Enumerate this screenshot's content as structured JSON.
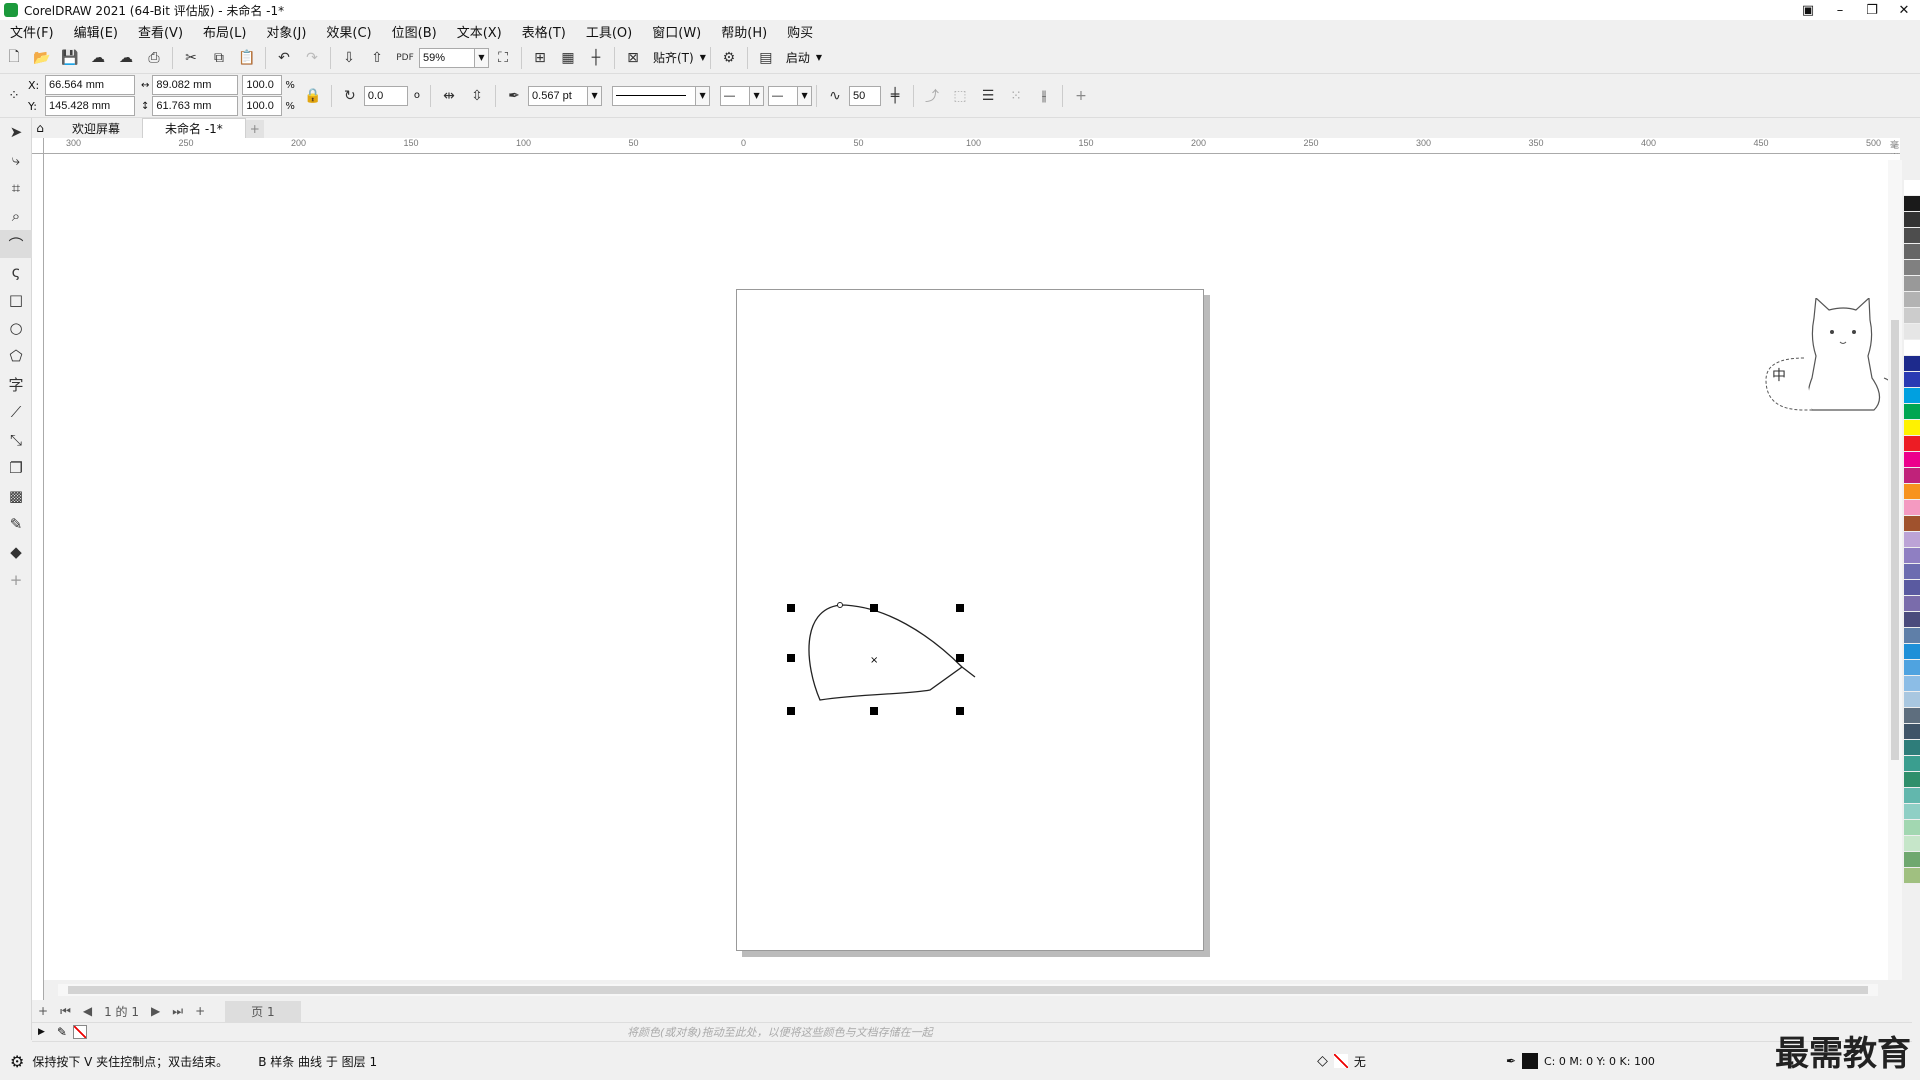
{
  "window": {
    "title": "CorelDRAW 2021 (64-Bit 评估版) - 未命名 -1*"
  },
  "menu": [
    "文件(F)",
    "编辑(E)",
    "查看(V)",
    "布局(L)",
    "对象(J)",
    "效果(C)",
    "位图(B)",
    "文本(X)",
    "表格(T)",
    "工具(O)",
    "窗口(W)",
    "帮助(H)",
    "购买"
  ],
  "toolbar1": {
    "zoom": "59%",
    "snap_label": "贴齐(T)",
    "launch_label": "启动"
  },
  "toolbar2": {
    "x_label": "X:",
    "x_value": "66.564 mm",
    "y_label": "Y:",
    "y_value": "145.428 mm",
    "w_value": "89.082 mm",
    "h_value": "61.763 mm",
    "sx_value": "100.0",
    "sy_value": "100.0",
    "pct": "%",
    "rotate_value": "0.0",
    "rotate_unit": "o",
    "outline_width": "0.567 pt",
    "smooth_value": "50"
  },
  "tabs": [
    {
      "label": "欢迎屏幕"
    },
    {
      "label": "未命名 -1*"
    }
  ],
  "ruler_h": [
    "300",
    "250",
    "200",
    "150",
    "100",
    "50",
    "0",
    "50",
    "100",
    "150",
    "200",
    "250",
    "300",
    "350",
    "400",
    "450",
    "500"
  ],
  "ruler_unit": "毫米",
  "pagebar": {
    "page_of": "1 的 1",
    "page_tab": "页 1"
  },
  "color_hint": "将颜色(或对象)拖动至此处，以便将这些颜色与文档存储在一起",
  "status": {
    "hint": "保持按下 V 夹住控制点；双击结束。",
    "object_info": "B 样条 曲线 于 图层 1",
    "fill_label": "无",
    "cmyk": "C: 0 M: 0 Y: 0 K: 100"
  },
  "mascot_text": "中",
  "watermark": "最需教育",
  "palette": [
    "#ffffff",
    "#1a1a1a",
    "#333333",
    "#4d4d4d",
    "#666666",
    "#808080",
    "#999999",
    "#b3b3b3",
    "#cccccc",
    "#e6e6e6",
    "#ffffff",
    "#1d2a8c",
    "#2a3ab3",
    "#00a0e0",
    "#00a651",
    "#fff200",
    "#ed1c24",
    "#ec008c",
    "#c0227a",
    "#f7931e",
    "#f49ac1",
    "#a0522d",
    "#bca3d6",
    "#8f7fc2",
    "#6c6cb0",
    "#5a5aa0",
    "#7a6cab",
    "#4b4b7c",
    "#5f7fa8",
    "#1e90d8",
    "#4fa3e0",
    "#8cbde6",
    "#a9c7e0",
    "#5e6e7e",
    "#3f5468",
    "#2e7d7a",
    "#3a9e8f",
    "#2f8f6b",
    "#62b7ad",
    "#8fcfc5",
    "#a2d7b1",
    "#c6e6c9",
    "#6fa86f",
    "#a0c080"
  ]
}
